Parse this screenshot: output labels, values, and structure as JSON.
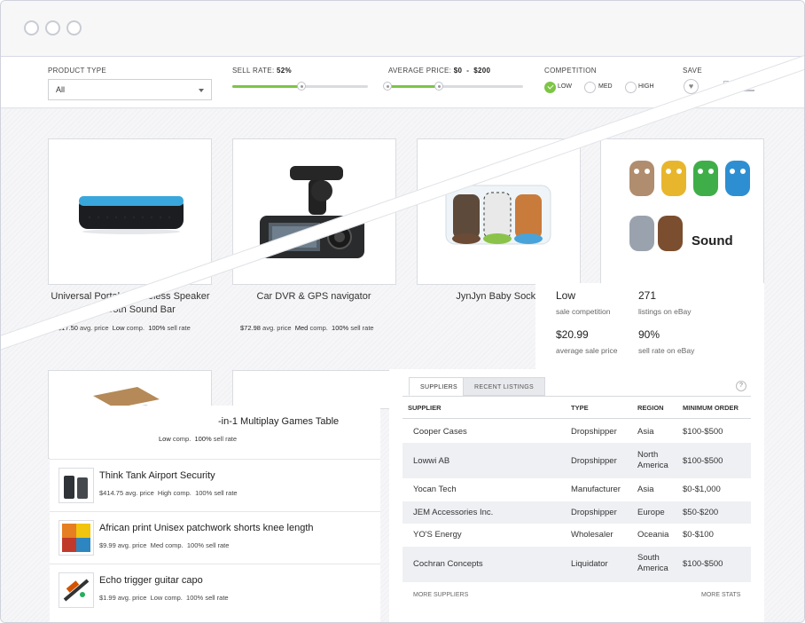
{
  "filters": {
    "product_type_label": "PRODUCT TYPE",
    "product_type_value": "All",
    "sell_rate_label": "SELL RATE:",
    "sell_rate_value": "52%",
    "sell_rate_fraction": 0.52,
    "avg_price_label": "AVERAGE PRICE:",
    "avg_price_value": "$0  -  $200",
    "competition_label": "COMPETITION",
    "competition_options": [
      "LOW",
      "MED",
      "HIGH"
    ],
    "competition_selected": "LOW",
    "save_label": "SAVE"
  },
  "products": [
    {
      "title": "Universal Portable Wireless Speaker Bluetooth Sound Bar",
      "price": "$17.50",
      "price_suffix": "avg. price",
      "comp": "Low",
      "comp_suffix": "comp.",
      "sell": "100%",
      "sell_suffix": "sell rate"
    },
    {
      "title": "Car DVR & GPS navigator",
      "price": "$72.98",
      "price_suffix": "avg. price",
      "comp": "Med",
      "comp_suffix": "comp.",
      "sell": "100%",
      "sell_suffix": "sell rate"
    },
    {
      "title": "JynJyn Baby Socks"
    },
    {
      "title": "Sound"
    }
  ],
  "detail_stats": [
    {
      "value": "Low",
      "label": "sale competition"
    },
    {
      "value": "271",
      "label": "listings on eBay"
    },
    {
      "value": "$20.99",
      "label": "average sale price"
    },
    {
      "value": "90%",
      "label": "sell rate on eBay"
    }
  ],
  "games_table": {
    "title_fragment": "-in-1 Multiplay Games Table",
    "meta_fragment": "Low",
    "comp_suffix": "comp.",
    "sell": "100%",
    "sell_suffix": "sell rate"
  },
  "list_items": [
    {
      "title": "Think Tank Airport Security",
      "price": "$414.75",
      "price_suffix": "avg. price",
      "comp": "High",
      "comp_suffix": "comp.",
      "sell": "100%",
      "sell_suffix": "sell rate"
    },
    {
      "title": "African print Unisex patchwork shorts knee length",
      "price": "$9.99",
      "price_suffix": "avg. price",
      "comp": "Med",
      "comp_suffix": "comp.",
      "sell": "100%",
      "sell_suffix": "sell rate"
    },
    {
      "title": "Echo trigger guitar capo",
      "price": "$1.99",
      "price_suffix": "avg. price",
      "comp": "Low",
      "comp_suffix": "comp.",
      "sell": "100%",
      "sell_suffix": "sell rate"
    }
  ],
  "suppliers": {
    "tabs": [
      "SUPPLIERS",
      "RECENT LISTINGS"
    ],
    "help": "?",
    "headers": [
      "SUPPLIER",
      "TYPE",
      "REGION",
      "MINIMUM ORDER"
    ],
    "rows": [
      {
        "name": "Cooper Cases",
        "type": "Dropshipper",
        "region": "Asia",
        "min": "$100-$500"
      },
      {
        "name": "Lowwi AB",
        "type": "Dropshipper",
        "region": "North America",
        "min": "$100-$500"
      },
      {
        "name": "Yocan Tech",
        "type": "Manufacturer",
        "region": "Asia",
        "min": "$0-$1,000"
      },
      {
        "name": "JEM Accessories Inc.",
        "type": "Dropshipper",
        "region": "Europe",
        "min": "$50-$200"
      },
      {
        "name": "YO'S Energy",
        "type": "Wholesaler",
        "region": "Oceania",
        "min": "$0-$100"
      },
      {
        "name": "Cochran Concepts",
        "type": "Liquidator",
        "region": "South America",
        "min": "$100-$500"
      }
    ],
    "more_suppliers": "MORE SUPPLIERS",
    "more_stats": "MORE STATS"
  },
  "colors": {
    "accent": "#7dc545",
    "speaker": "#39a9e0"
  }
}
